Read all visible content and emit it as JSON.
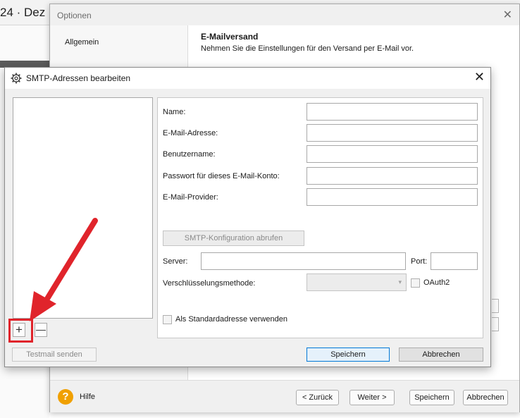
{
  "background_app": {
    "title_fragment": "24 · Dez"
  },
  "options_window": {
    "title": "Optionen",
    "close_glyph": "✕",
    "nav_item": "Allgemein",
    "heading": "E-Mailversand",
    "subheading": "Nehmen Sie die Einstellungen für den Versand per E-Mail vor.",
    "help_glyph": "?",
    "help_label": "Hilfe",
    "back_label": "< Zurück",
    "next_label": "Weiter >",
    "save_label": "Speichern",
    "cancel_label": "Abbrechen"
  },
  "smtp_dialog": {
    "title": "SMTP-Adressen bearbeiten",
    "icon": "gear-icon",
    "close_glyph": "✕",
    "add_glyph": "+",
    "remove_glyph": "—",
    "testmail_label": "Testmail senden",
    "fields": {
      "name": "Name:",
      "email": "E-Mail-Adresse:",
      "username": "Benutzername:",
      "password": "Passwort für dieses E-Mail-Konto:",
      "provider": "E-Mail-Provider:"
    },
    "fetch_config_label": "SMTP-Konfiguration abrufen",
    "server_label": "Server:",
    "port_label": "Port:",
    "encryption_label": "Verschlüsselungsmethode:",
    "select_arrow": "▾",
    "oauth_label": "OAuth2",
    "default_label": "Als Standardadresse verwenden",
    "save_label": "Speichern",
    "cancel_label": "Abbrechen"
  },
  "annotation": {
    "color": "#e0242b"
  }
}
